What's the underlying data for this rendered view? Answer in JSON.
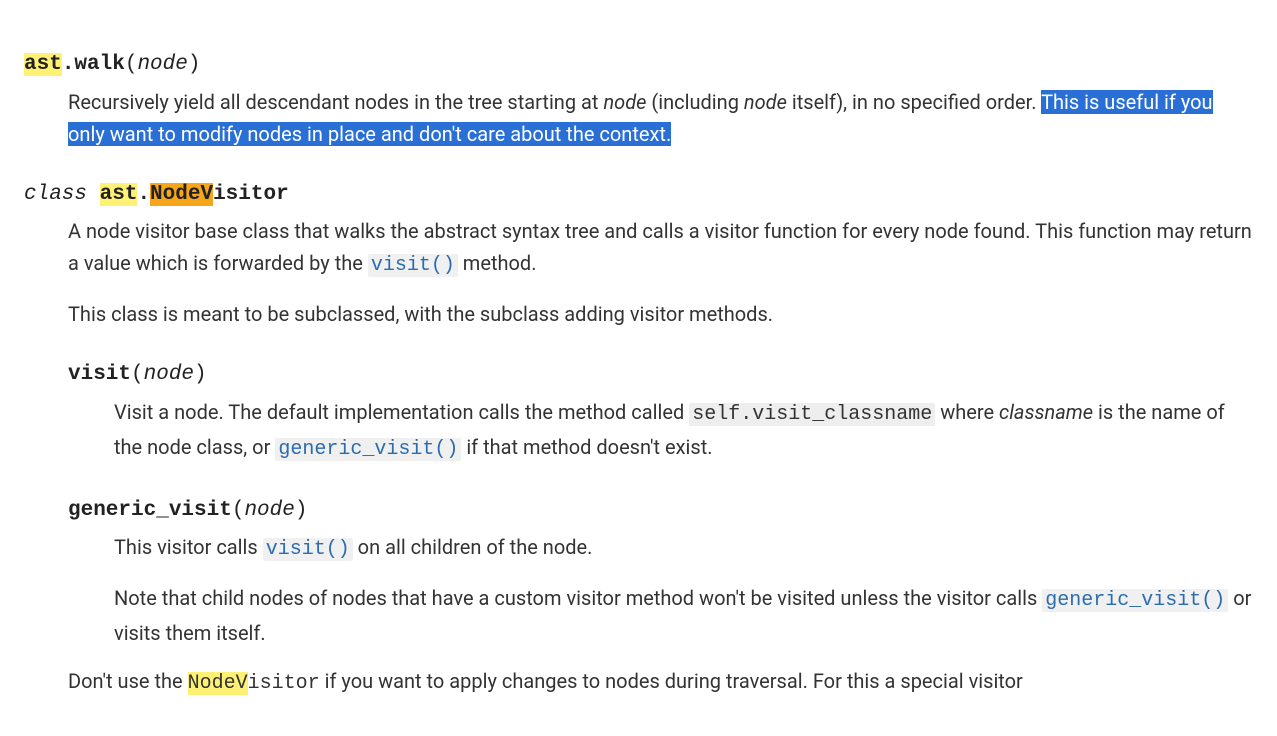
{
  "walk": {
    "module": "ast",
    "name": "walk",
    "param": "node",
    "desc_prefix": "Recursively yield all descendant nodes in the tree starting at ",
    "desc_node1": "node",
    "desc_mid1": " (including ",
    "desc_node2": "node",
    "desc_mid2": " itself), in no specified order. ",
    "desc_hl": "This is useful if you only want to modify nodes in place and don't care about the context."
  },
  "nodevisitor": {
    "class_kw": "class ",
    "module": "ast",
    "name_hl": "NodeV",
    "name_rest": "isitor",
    "desc_p1_a": "A node visitor base class that walks the abstract syntax tree and calls a visitor function for every node found. This function may return a value which is forwarded by the ",
    "desc_p1_ref": "visit()",
    "desc_p1_b": " method.",
    "desc_p2": "This class is meant to be subclassed, with the subclass adding visitor methods."
  },
  "visit": {
    "name": "visit",
    "param": "node",
    "d1": "Visit a node. The default implementation calls the method called ",
    "lit": "self.visit_classname",
    "d2": " where ",
    "cls": "classname",
    "d3": " is the name of the node class, or ",
    "ref": "generic_visit()",
    "d4": " if that method doesn't exist."
  },
  "generic_visit": {
    "name": "generic_visit",
    "param": "node",
    "p1a": "This visitor calls ",
    "p1ref": "visit()",
    "p1b": " on all children of the node.",
    "p2a": "Note that child nodes of nodes that have a custom visitor method won't be visited unless the visitor calls ",
    "p2ref": "generic_visit()",
    "p2b": " or visits them itself."
  },
  "footer": {
    "a": "Don't use the ",
    "hl": "NodeV",
    "rest": "isitor",
    "b": " if you want to apply changes to nodes during traversal. For this a special visitor"
  }
}
